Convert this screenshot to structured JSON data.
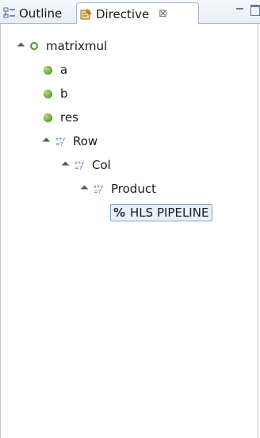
{
  "tabs": [
    {
      "label": "Outline",
      "icon": "outline-icon"
    },
    {
      "label": "Directive",
      "icon": "directive-icon",
      "close_glyph": "⊠",
      "active": true
    }
  ],
  "tree": {
    "root": {
      "label": "matrixmul",
      "icon": "function-icon"
    },
    "vars": [
      {
        "label": "a",
        "icon": "variable-icon"
      },
      {
        "label": "b",
        "icon": "variable-icon"
      },
      {
        "label": "res",
        "icon": "variable-icon"
      }
    ],
    "loops": [
      {
        "label": "Row",
        "icon": "loop-icon"
      },
      {
        "label": "Col",
        "icon": "loop-icon"
      },
      {
        "label": "Product",
        "icon": "loop-icon"
      }
    ],
    "directive": {
      "glyph": "%",
      "label": "HLS PIPELINE"
    }
  },
  "colors": {
    "accent": "#7da2ce",
    "variable": "#5c9a2c"
  }
}
